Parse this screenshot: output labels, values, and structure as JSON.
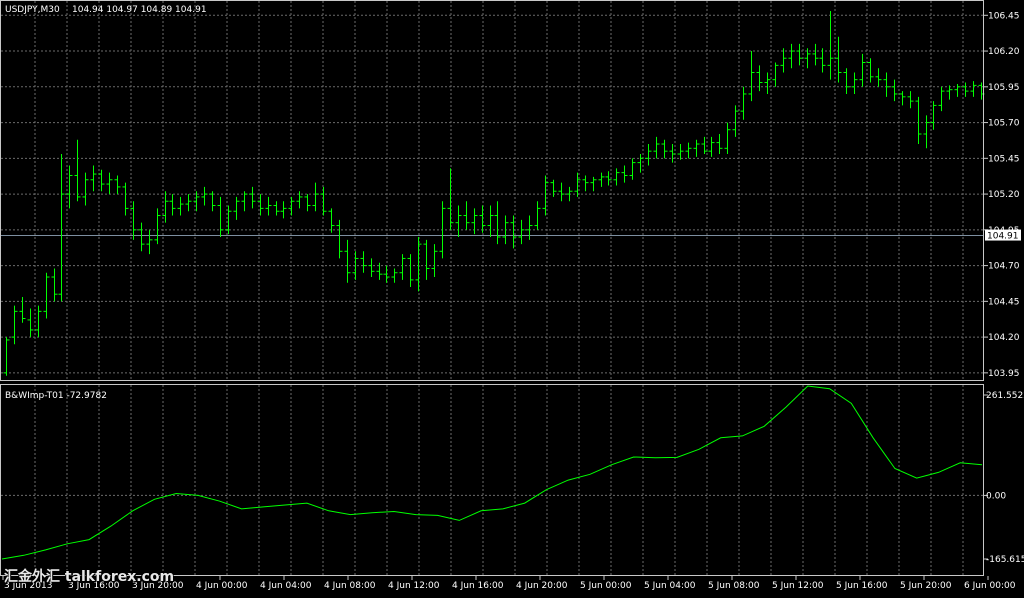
{
  "chart_data": [
    {
      "type": "bar",
      "title": "USDJPY,M30",
      "ohlc_label": "104.94 104.97 104.89 104.91",
      "last_price": "104.91",
      "last_price_value": 104.91,
      "ylim": [
        103.9,
        106.55
      ],
      "y_ticks": [
        "106.45",
        "106.20",
        "105.95",
        "105.70",
        "105.45",
        "105.20",
        "104.95",
        "104.70",
        "104.45",
        "104.20",
        "103.95"
      ],
      "grid": true,
      "bar_color": "#00ff00",
      "grid_color": "#6b6b6b",
      "price_line_color": "#7d8fa0",
      "bars": [
        {
          "i": 0,
          "o": 103.95,
          "h": 104.2,
          "l": 103.93,
          "c": 104.18
        },
        {
          "i": 1,
          "o": 104.2,
          "h": 104.42,
          "l": 104.15,
          "c": 104.38
        },
        {
          "i": 2,
          "o": 104.38,
          "h": 104.48,
          "l": 104.3,
          "c": 104.33
        },
        {
          "i": 3,
          "o": 104.32,
          "h": 104.4,
          "l": 104.2,
          "c": 104.25
        },
        {
          "i": 4,
          "o": 104.25,
          "h": 104.42,
          "l": 104.2,
          "c": 104.38
        },
        {
          "i": 5,
          "o": 104.38,
          "h": 104.65,
          "l": 104.33,
          "c": 104.62
        },
        {
          "i": 6,
          "o": 104.62,
          "h": 104.68,
          "l": 104.45,
          "c": 104.5
        },
        {
          "i": 7,
          "o": 104.5,
          "h": 105.48,
          "l": 104.45,
          "c": 105.2
        },
        {
          "i": 8,
          "o": 105.2,
          "h": 105.4,
          "l": 105.1,
          "c": 105.33
        },
        {
          "i": 9,
          "o": 105.33,
          "h": 105.58,
          "l": 105.15,
          "c": 105.18
        },
        {
          "i": 10,
          "o": 105.18,
          "h": 105.35,
          "l": 105.12,
          "c": 105.3
        },
        {
          "i": 11,
          "o": 105.3,
          "h": 105.4,
          "l": 105.22,
          "c": 105.34
        },
        {
          "i": 12,
          "o": 105.34,
          "h": 105.37,
          "l": 105.22,
          "c": 105.27
        },
        {
          "i": 13,
          "o": 105.27,
          "h": 105.35,
          "l": 105.2,
          "c": 105.3
        },
        {
          "i": 14,
          "o": 105.3,
          "h": 105.33,
          "l": 105.2,
          "c": 105.25
        },
        {
          "i": 15,
          "o": 105.25,
          "h": 105.28,
          "l": 105.05,
          "c": 105.1
        },
        {
          "i": 16,
          "o": 105.1,
          "h": 105.15,
          "l": 104.88,
          "c": 104.95
        },
        {
          "i": 17,
          "o": 104.95,
          "h": 105.0,
          "l": 104.8,
          "c": 104.85
        },
        {
          "i": 18,
          "o": 104.85,
          "h": 104.95,
          "l": 104.78,
          "c": 104.88
        },
        {
          "i": 19,
          "o": 104.88,
          "h": 105.1,
          "l": 104.85,
          "c": 105.05
        },
        {
          "i": 20,
          "o": 105.05,
          "h": 105.22,
          "l": 105.0,
          "c": 105.15
        },
        {
          "i": 21,
          "o": 105.15,
          "h": 105.2,
          "l": 105.05,
          "c": 105.1
        },
        {
          "i": 22,
          "o": 105.1,
          "h": 105.18,
          "l": 105.05,
          "c": 105.13
        },
        {
          "i": 23,
          "o": 105.13,
          "h": 105.2,
          "l": 105.08,
          "c": 105.15
        },
        {
          "i": 24,
          "o": 105.15,
          "h": 105.22,
          "l": 105.08,
          "c": 105.18
        },
        {
          "i": 25,
          "o": 105.18,
          "h": 105.25,
          "l": 105.12,
          "c": 105.2
        },
        {
          "i": 26,
          "o": 105.2,
          "h": 105.22,
          "l": 105.08,
          "c": 105.12
        },
        {
          "i": 27,
          "o": 105.12,
          "h": 105.18,
          "l": 104.9,
          "c": 104.95
        },
        {
          "i": 28,
          "o": 104.95,
          "h": 105.12,
          "l": 104.92,
          "c": 105.08
        },
        {
          "i": 29,
          "o": 105.08,
          "h": 105.18,
          "l": 105.02,
          "c": 105.15
        },
        {
          "i": 30,
          "o": 105.15,
          "h": 105.22,
          "l": 105.08,
          "c": 105.2
        },
        {
          "i": 31,
          "o": 105.2,
          "h": 105.25,
          "l": 105.1,
          "c": 105.15
        },
        {
          "i": 32,
          "o": 105.15,
          "h": 105.2,
          "l": 105.05,
          "c": 105.1
        },
        {
          "i": 33,
          "o": 105.1,
          "h": 105.18,
          "l": 105.05,
          "c": 105.12
        },
        {
          "i": 34,
          "o": 105.12,
          "h": 105.15,
          "l": 105.05,
          "c": 105.08
        },
        {
          "i": 35,
          "o": 105.08,
          "h": 105.15,
          "l": 105.03,
          "c": 105.1
        },
        {
          "i": 36,
          "o": 105.1,
          "h": 105.18,
          "l": 105.05,
          "c": 105.15
        },
        {
          "i": 37,
          "o": 105.15,
          "h": 105.22,
          "l": 105.1,
          "c": 105.18
        },
        {
          "i": 38,
          "o": 105.18,
          "h": 105.2,
          "l": 105.08,
          "c": 105.12
        },
        {
          "i": 39,
          "o": 105.12,
          "h": 105.28,
          "l": 105.08,
          "c": 105.2
        },
        {
          "i": 40,
          "o": 105.2,
          "h": 105.25,
          "l": 105.05,
          "c": 105.08
        },
        {
          "i": 41,
          "o": 105.08,
          "h": 105.1,
          "l": 104.93,
          "c": 104.98
        },
        {
          "i": 42,
          "o": 104.98,
          "h": 105.02,
          "l": 104.75,
          "c": 104.8
        },
        {
          "i": 43,
          "o": 104.8,
          "h": 104.88,
          "l": 104.58,
          "c": 104.65
        },
        {
          "i": 44,
          "o": 104.65,
          "h": 104.8,
          "l": 104.6,
          "c": 104.75
        },
        {
          "i": 45,
          "o": 104.75,
          "h": 104.8,
          "l": 104.65,
          "c": 104.7
        },
        {
          "i": 46,
          "o": 104.7,
          "h": 104.75,
          "l": 104.62,
          "c": 104.66
        },
        {
          "i": 47,
          "o": 104.66,
          "h": 104.72,
          "l": 104.6,
          "c": 104.64
        },
        {
          "i": 48,
          "o": 104.64,
          "h": 104.7,
          "l": 104.58,
          "c": 104.62
        },
        {
          "i": 49,
          "o": 104.62,
          "h": 104.68,
          "l": 104.58,
          "c": 104.65
        },
        {
          "i": 50,
          "o": 104.65,
          "h": 104.78,
          "l": 104.6,
          "c": 104.75
        },
        {
          "i": 51,
          "o": 104.75,
          "h": 104.78,
          "l": 104.55,
          "c": 104.6
        },
        {
          "i": 52,
          "o": 104.6,
          "h": 104.9,
          "l": 104.52,
          "c": 104.85
        },
        {
          "i": 53,
          "o": 104.85,
          "h": 104.88,
          "l": 104.6,
          "c": 104.68
        },
        {
          "i": 54,
          "o": 104.68,
          "h": 104.85,
          "l": 104.62,
          "c": 104.8
        },
        {
          "i": 55,
          "o": 104.8,
          "h": 105.15,
          "l": 104.75,
          "c": 105.1
        },
        {
          "i": 56,
          "o": 105.1,
          "h": 105.38,
          "l": 104.95,
          "c": 105.0
        },
        {
          "i": 57,
          "o": 105.0,
          "h": 105.12,
          "l": 104.9,
          "c": 105.05
        },
        {
          "i": 58,
          "o": 105.05,
          "h": 105.15,
          "l": 104.95,
          "c": 105.0
        },
        {
          "i": 59,
          "o": 105.0,
          "h": 105.1,
          "l": 104.92,
          "c": 105.05
        },
        {
          "i": 60,
          "o": 105.05,
          "h": 105.12,
          "l": 104.93,
          "c": 104.98
        },
        {
          "i": 61,
          "o": 104.98,
          "h": 105.12,
          "l": 104.9,
          "c": 105.05
        },
        {
          "i": 62,
          "o": 105.05,
          "h": 105.15,
          "l": 104.85,
          "c": 104.9
        },
        {
          "i": 63,
          "o": 104.9,
          "h": 105.05,
          "l": 104.85,
          "c": 105.0
        },
        {
          "i": 64,
          "o": 105.0,
          "h": 105.05,
          "l": 104.82,
          "c": 104.9
        },
        {
          "i": 65,
          "o": 104.9,
          "h": 105.02,
          "l": 104.85,
          "c": 104.95
        },
        {
          "i": 66,
          "o": 104.95,
          "h": 105.05,
          "l": 104.88,
          "c": 104.98
        },
        {
          "i": 67,
          "o": 104.98,
          "h": 105.15,
          "l": 104.95,
          "c": 105.1
        },
        {
          "i": 68,
          "o": 105.1,
          "h": 105.33,
          "l": 105.05,
          "c": 105.28
        },
        {
          "i": 69,
          "o": 105.28,
          "h": 105.3,
          "l": 105.18,
          "c": 105.22
        },
        {
          "i": 70,
          "o": 105.22,
          "h": 105.28,
          "l": 105.15,
          "c": 105.2
        },
        {
          "i": 71,
          "o": 105.2,
          "h": 105.25,
          "l": 105.15,
          "c": 105.22
        },
        {
          "i": 72,
          "o": 105.22,
          "h": 105.35,
          "l": 105.18,
          "c": 105.3
        },
        {
          "i": 73,
          "o": 105.3,
          "h": 105.33,
          "l": 105.22,
          "c": 105.28
        },
        {
          "i": 74,
          "o": 105.28,
          "h": 105.32,
          "l": 105.22,
          "c": 105.3
        },
        {
          "i": 75,
          "o": 105.3,
          "h": 105.35,
          "l": 105.25,
          "c": 105.32
        },
        {
          "i": 76,
          "o": 105.32,
          "h": 105.36,
          "l": 105.26,
          "c": 105.3
        },
        {
          "i": 77,
          "o": 105.3,
          "h": 105.38,
          "l": 105.26,
          "c": 105.35
        },
        {
          "i": 78,
          "o": 105.35,
          "h": 105.4,
          "l": 105.28,
          "c": 105.33
        },
        {
          "i": 79,
          "o": 105.33,
          "h": 105.45,
          "l": 105.3,
          "c": 105.42
        },
        {
          "i": 80,
          "o": 105.42,
          "h": 105.48,
          "l": 105.35,
          "c": 105.45
        },
        {
          "i": 81,
          "o": 105.45,
          "h": 105.55,
          "l": 105.4,
          "c": 105.5
        },
        {
          "i": 82,
          "o": 105.5,
          "h": 105.6,
          "l": 105.45,
          "c": 105.55
        },
        {
          "i": 83,
          "o": 105.55,
          "h": 105.58,
          "l": 105.45,
          "c": 105.5
        },
        {
          "i": 84,
          "o": 105.5,
          "h": 105.55,
          "l": 105.42,
          "c": 105.48
        },
        {
          "i": 85,
          "o": 105.48,
          "h": 105.55,
          "l": 105.44,
          "c": 105.5
        },
        {
          "i": 86,
          "o": 105.5,
          "h": 105.56,
          "l": 105.45,
          "c": 105.52
        },
        {
          "i": 87,
          "o": 105.52,
          "h": 105.58,
          "l": 105.46,
          "c": 105.55
        },
        {
          "i": 88,
          "o": 105.55,
          "h": 105.6,
          "l": 105.48,
          "c": 105.5
        },
        {
          "i": 89,
          "o": 105.5,
          "h": 105.6,
          "l": 105.46,
          "c": 105.56
        },
        {
          "i": 90,
          "o": 105.56,
          "h": 105.62,
          "l": 105.48,
          "c": 105.52
        },
        {
          "i": 91,
          "o": 105.52,
          "h": 105.7,
          "l": 105.48,
          "c": 105.65
        },
        {
          "i": 92,
          "o": 105.65,
          "h": 105.82,
          "l": 105.6,
          "c": 105.78
        },
        {
          "i": 93,
          "o": 105.78,
          "h": 105.95,
          "l": 105.72,
          "c": 105.9
        },
        {
          "i": 94,
          "o": 105.9,
          "h": 106.2,
          "l": 105.85,
          "c": 106.05
        },
        {
          "i": 95,
          "o": 106.05,
          "h": 106.1,
          "l": 105.92,
          "c": 105.98
        },
        {
          "i": 96,
          "o": 105.98,
          "h": 106.05,
          "l": 105.9,
          "c": 106.0
        },
        {
          "i": 97,
          "o": 106.0,
          "h": 106.12,
          "l": 105.95,
          "c": 106.1
        },
        {
          "i": 98,
          "o": 106.1,
          "h": 106.22,
          "l": 106.05,
          "c": 106.15
        },
        {
          "i": 99,
          "o": 106.15,
          "h": 106.25,
          "l": 106.08,
          "c": 106.2
        },
        {
          "i": 100,
          "o": 106.2,
          "h": 106.25,
          "l": 106.1,
          "c": 106.15
        },
        {
          "i": 101,
          "o": 106.15,
          "h": 106.22,
          "l": 106.08,
          "c": 106.18
        },
        {
          "i": 102,
          "o": 106.18,
          "h": 106.25,
          "l": 106.1,
          "c": 106.15
        },
        {
          "i": 103,
          "o": 106.15,
          "h": 106.22,
          "l": 106.05,
          "c": 106.1
        },
        {
          "i": 104,
          "o": 106.1,
          "h": 106.48,
          "l": 106.0,
          "c": 106.15
        },
        {
          "i": 105,
          "o": 106.15,
          "h": 106.3,
          "l": 105.98,
          "c": 106.05
        },
        {
          "i": 106,
          "o": 106.05,
          "h": 106.08,
          "l": 105.9,
          "c": 105.95
        },
        {
          "i": 107,
          "o": 105.95,
          "h": 106.05,
          "l": 105.9,
          "c": 106.0
        },
        {
          "i": 108,
          "o": 106.0,
          "h": 106.18,
          "l": 105.95,
          "c": 106.12
        },
        {
          "i": 109,
          "o": 106.12,
          "h": 106.15,
          "l": 105.98,
          "c": 106.02
        },
        {
          "i": 110,
          "o": 106.02,
          "h": 106.08,
          "l": 105.95,
          "c": 106.0
        },
        {
          "i": 111,
          "o": 106.0,
          "h": 106.05,
          "l": 105.88,
          "c": 105.95
        },
        {
          "i": 112,
          "o": 105.95,
          "h": 106.0,
          "l": 105.85,
          "c": 105.9
        },
        {
          "i": 113,
          "o": 105.9,
          "h": 105.92,
          "l": 105.82,
          "c": 105.88
        },
        {
          "i": 114,
          "o": 105.88,
          "h": 105.92,
          "l": 105.8,
          "c": 105.85
        },
        {
          "i": 115,
          "o": 105.85,
          "h": 105.88,
          "l": 105.55,
          "c": 105.62
        },
        {
          "i": 116,
          "o": 105.62,
          "h": 105.75,
          "l": 105.52,
          "c": 105.7
        },
        {
          "i": 117,
          "o": 105.7,
          "h": 105.85,
          "l": 105.65,
          "c": 105.82
        },
        {
          "i": 118,
          "o": 105.82,
          "h": 105.95,
          "l": 105.78,
          "c": 105.92
        },
        {
          "i": 119,
          "o": 105.92,
          "h": 105.96,
          "l": 105.86,
          "c": 105.93
        },
        {
          "i": 120,
          "o": 105.93,
          "h": 105.97,
          "l": 105.88,
          "c": 105.95
        },
        {
          "i": 121,
          "o": 105.95,
          "h": 105.98,
          "l": 105.88,
          "c": 105.92
        },
        {
          "i": 122,
          "o": 105.92,
          "h": 105.99,
          "l": 105.88,
          "c": 105.96
        },
        {
          "i": 123,
          "o": 105.96,
          "h": 105.98,
          "l": 105.86,
          "c": 105.9
        }
      ]
    },
    {
      "type": "line",
      "title": "B&WImp-T01 -72.9782",
      "ylim": [
        -165.615,
        261.5522
      ],
      "y_ticks": [
        "261.5522",
        "0.00",
        "-165.615"
      ],
      "line_color": "#00ff00",
      "series": [
        {
          "values": [
            -165.6,
            -156,
            -142,
            -126,
            -115,
            -80,
            -40,
            -10,
            5,
            0,
            -15,
            -35,
            -30,
            -25,
            -20,
            -40,
            -50,
            -45,
            -42,
            -50,
            -52,
            -65,
            -40,
            -35,
            -20,
            15,
            40,
            55,
            80,
            100,
            98,
            99,
            120,
            150,
            155,
            180,
            230,
            285,
            278,
            240,
            150,
            70,
            45,
            60,
            85,
            80
          ]
        }
      ]
    }
  ],
  "x_ticks": [
    "3 Jun 2013",
    "3 Jun 16:00",
    "3 Jun 20:00",
    "4 Jun 00:00",
    "4 Jun 04:00",
    "4 Jun 08:00",
    "4 Jun 12:00",
    "4 Jun 16:00",
    "4 Jun 20:00",
    "5 Jun 00:00",
    "5 Jun 04:00",
    "5 Jun 08:00",
    "5 Jun 12:00",
    "5 Jun 16:00",
    "5 Jun 20:00",
    "6 Jun 00:00"
  ],
  "watermark": "汇金外汇 talkforex.com"
}
